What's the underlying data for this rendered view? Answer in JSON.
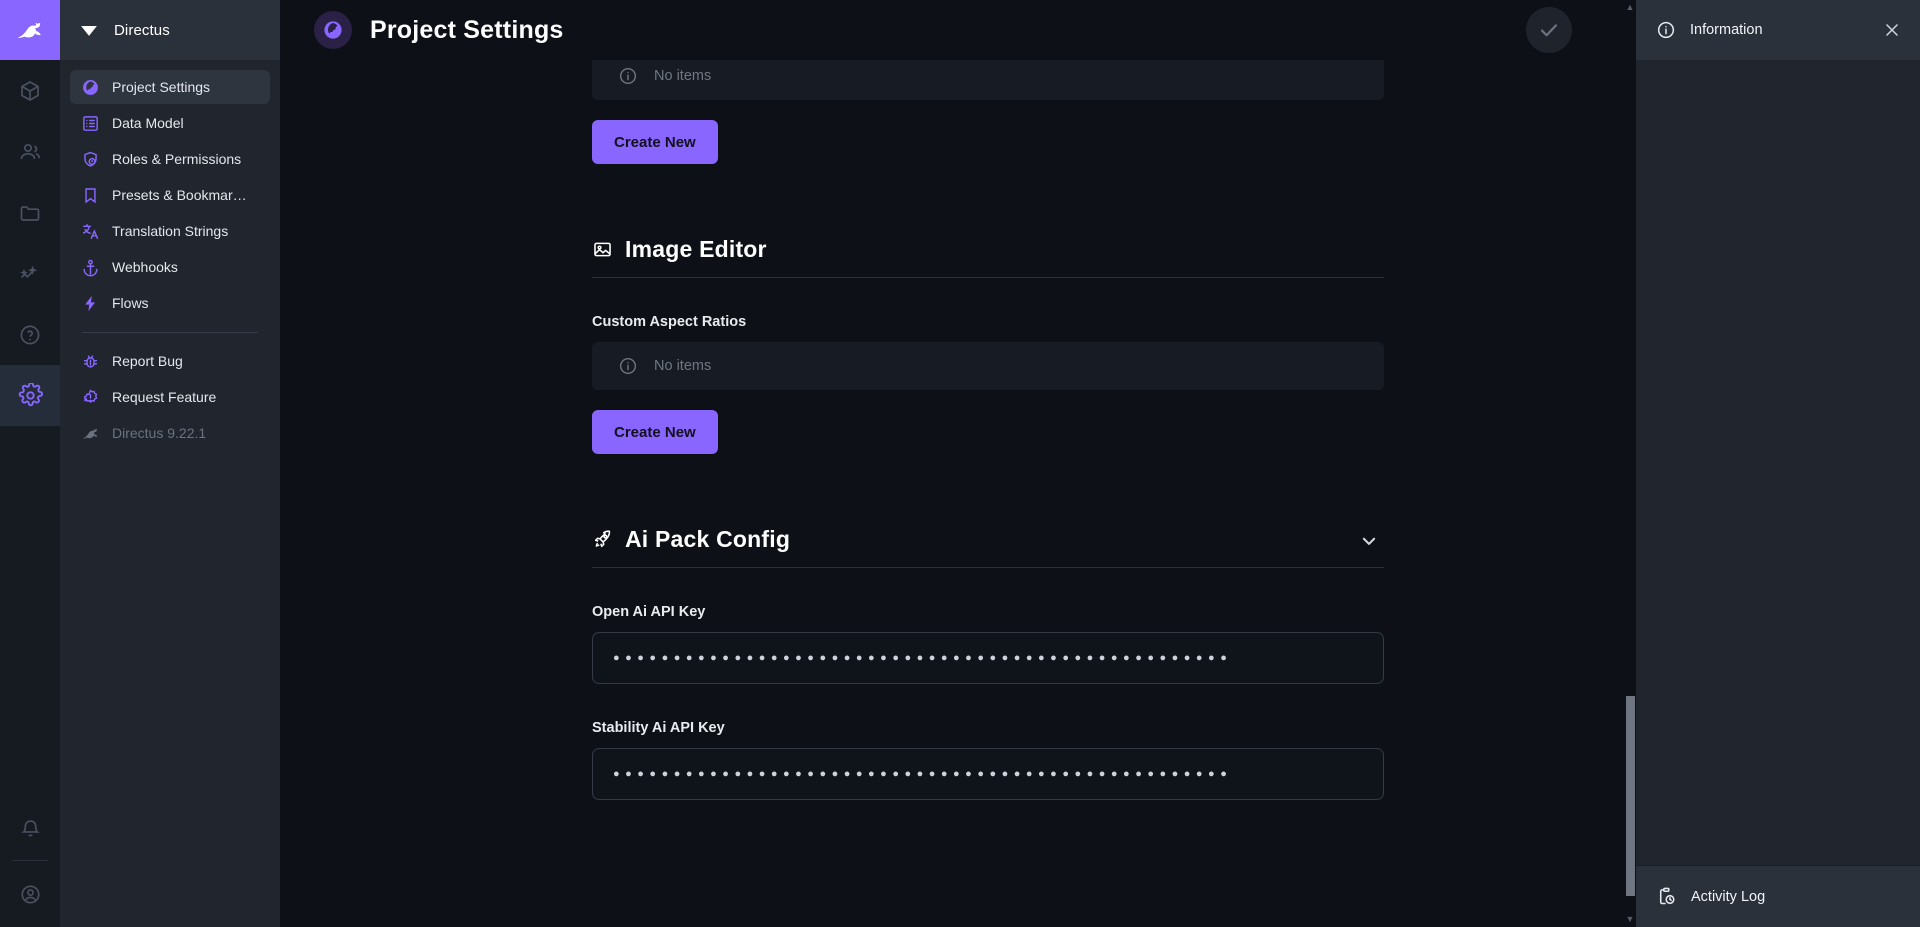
{
  "app": {
    "brand": "Directus",
    "version_label": "Directus 9.22.1"
  },
  "rail": {
    "logo_icon": "rabbit-logo-icon",
    "items": [
      {
        "name": "content",
        "icon": "box-icon",
        "active": false
      },
      {
        "name": "users",
        "icon": "people-icon",
        "active": false
      },
      {
        "name": "files",
        "icon": "folder-icon",
        "active": false
      },
      {
        "name": "insights",
        "icon": "chart-sparkle-icon",
        "active": false
      },
      {
        "name": "docs",
        "icon": "question-circle-icon",
        "active": false
      },
      {
        "name": "settings",
        "icon": "gear-icon",
        "active": true
      }
    ],
    "bottom": [
      {
        "name": "notifications",
        "icon": "bell-icon"
      },
      {
        "name": "account",
        "icon": "user-circle-icon"
      }
    ]
  },
  "sidebar": {
    "header_title": "Directus",
    "header_icon": "directus-wordmark-icon",
    "items": [
      {
        "label": "Project Settings",
        "icon": "globe-icon",
        "active": true
      },
      {
        "label": "Data Model",
        "icon": "list-box-icon",
        "active": false
      },
      {
        "label": "Roles & Permissions",
        "icon": "shield-user-icon",
        "active": false
      },
      {
        "label": "Presets & Bookmar…",
        "icon": "bookmark-icon",
        "active": false
      },
      {
        "label": "Translation Strings",
        "icon": "translate-icon",
        "active": false
      },
      {
        "label": "Webhooks",
        "icon": "anchor-icon",
        "active": false
      },
      {
        "label": "Flows",
        "icon": "bolt-icon",
        "active": false
      }
    ],
    "secondary_items": [
      {
        "label": "Report Bug",
        "icon": "bug-icon",
        "muted": false
      },
      {
        "label": "Request Feature",
        "icon": "alert-badge-icon",
        "muted": false
      },
      {
        "label": "Directus 9.22.1",
        "icon": "rabbit-icon",
        "muted": true
      }
    ]
  },
  "header": {
    "title": "Project Settings",
    "badge_icon": "globe-icon",
    "save_icon": "check-icon",
    "save_label": "Save"
  },
  "content": {
    "top_empty": {
      "icon": "info-circle-icon",
      "text": "No items"
    },
    "top_create_button": "Create New",
    "image_editor": {
      "icon": "image-icon",
      "title": "Image Editor",
      "field_label": "Custom Aspect Ratios",
      "empty": {
        "icon": "info-circle-icon",
        "text": "No items"
      },
      "create_button": "Create New"
    },
    "ai_pack": {
      "icon": "rocket-icon",
      "title": "Ai Pack Config",
      "collapse_icon": "chevron-down-icon",
      "fields": [
        {
          "label": "Open Ai API Key",
          "value_masked": "●●●●●●●●●●●●●●●●●●●●●●●●●●●●●●●●●●●●●●●●●●●●●●●●●●●",
          "type": "password"
        },
        {
          "label": "Stability Ai API Key",
          "value_masked": "●●●●●●●●●●●●●●●●●●●●●●●●●●●●●●●●●●●●●●●●●●●●●●●●●●●",
          "type": "password"
        }
      ]
    }
  },
  "drawer": {
    "title": "Information",
    "icon": "info-circle-icon",
    "close_icon": "close-icon",
    "footer_label": "Activity Log",
    "footer_icon": "clipboard-clock-icon"
  },
  "colors": {
    "accent": "#8866ff",
    "background": "#0d1117",
    "panel": "#21262e",
    "panel_header": "#2b313b",
    "input_bg": "#0f141b",
    "border": "#343b46"
  }
}
